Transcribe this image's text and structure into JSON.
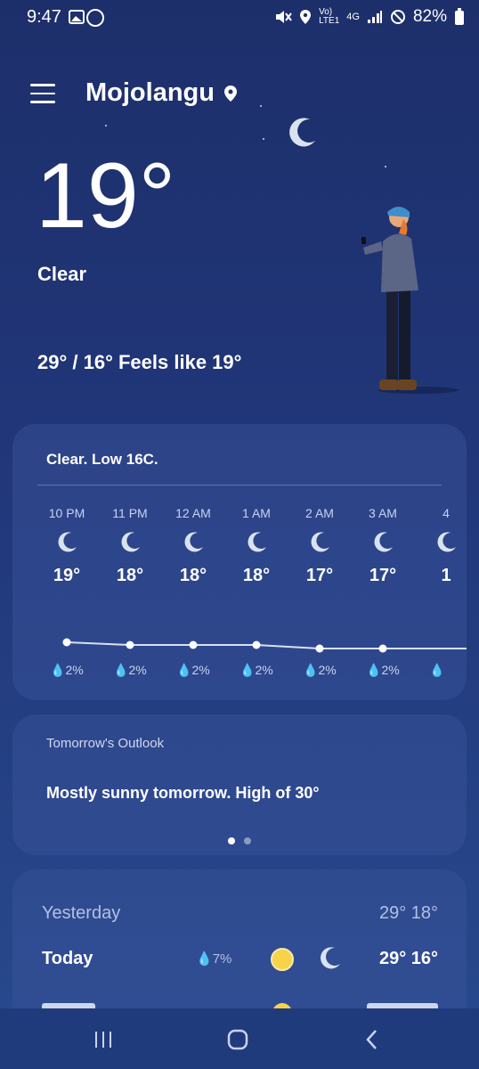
{
  "status_bar": {
    "time": "9:47",
    "battery": "82%",
    "network": "4G"
  },
  "location": {
    "name": "Mojolangu"
  },
  "current": {
    "temperature": "19°",
    "condition": "Clear",
    "hi_lo_feels": "29° / 16° Feels like 19°"
  },
  "hourly": {
    "summary": "Clear. Low 16C.",
    "items": [
      {
        "time": "10 PM",
        "temp": "19°",
        "precip": "2%"
      },
      {
        "time": "11 PM",
        "temp": "18°",
        "precip": "2%"
      },
      {
        "time": "12 AM",
        "temp": "18°",
        "precip": "2%"
      },
      {
        "time": "1 AM",
        "temp": "18°",
        "precip": "2%"
      },
      {
        "time": "2 AM",
        "temp": "17°",
        "precip": "2%"
      },
      {
        "time": "3 AM",
        "temp": "17°",
        "precip": "2%"
      },
      {
        "time": "4",
        "temp": "1",
        "precip": ""
      }
    ]
  },
  "outlook": {
    "title": "Tomorrow's Outlook",
    "text": "Mostly sunny tomorrow. High of 30°"
  },
  "daily": {
    "yesterday": {
      "label": "Yesterday",
      "temps": "29° 18°"
    },
    "today": {
      "label": "Today",
      "precip": "7%",
      "temps": "29° 16°"
    }
  },
  "colors": {
    "accent": "#f7d34a",
    "bg_top": "#1d2f6b"
  }
}
